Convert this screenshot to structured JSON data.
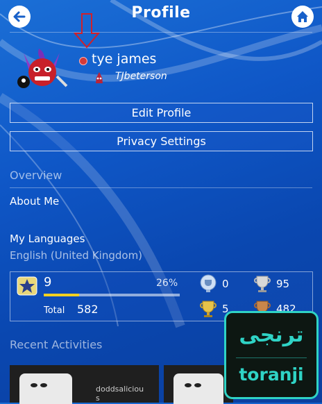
{
  "header": {
    "title": "Profile",
    "back_icon": "arrow-left-icon",
    "home_icon": "home-icon"
  },
  "profile": {
    "name": "tye james",
    "online_id": "TJbeterson"
  },
  "actions": {
    "edit_profile": "Edit Profile",
    "privacy_settings": "Privacy Settings"
  },
  "overview": {
    "heading": "Overview",
    "about_label": "About Me",
    "languages_label": "My Languages",
    "languages_value": "English (United Kingdom)"
  },
  "trophies": {
    "level": "9",
    "progress_text": "26%",
    "progress_fraction": 0.26,
    "total_label": "Total",
    "total": "582",
    "platinum": "0",
    "gold": "5",
    "silver": "95",
    "bronze": "482"
  },
  "recent": {
    "heading": "Recent Activities",
    "items": [
      {
        "user": "doddsalicious"
      }
    ]
  },
  "watermark": {
    "arabic": "ترنجی",
    "latin": "toranji"
  },
  "colors": {
    "accent": "#2fd3c5",
    "bar_fill": "#f2d020",
    "annotation_arrow": "#d0202a"
  }
}
